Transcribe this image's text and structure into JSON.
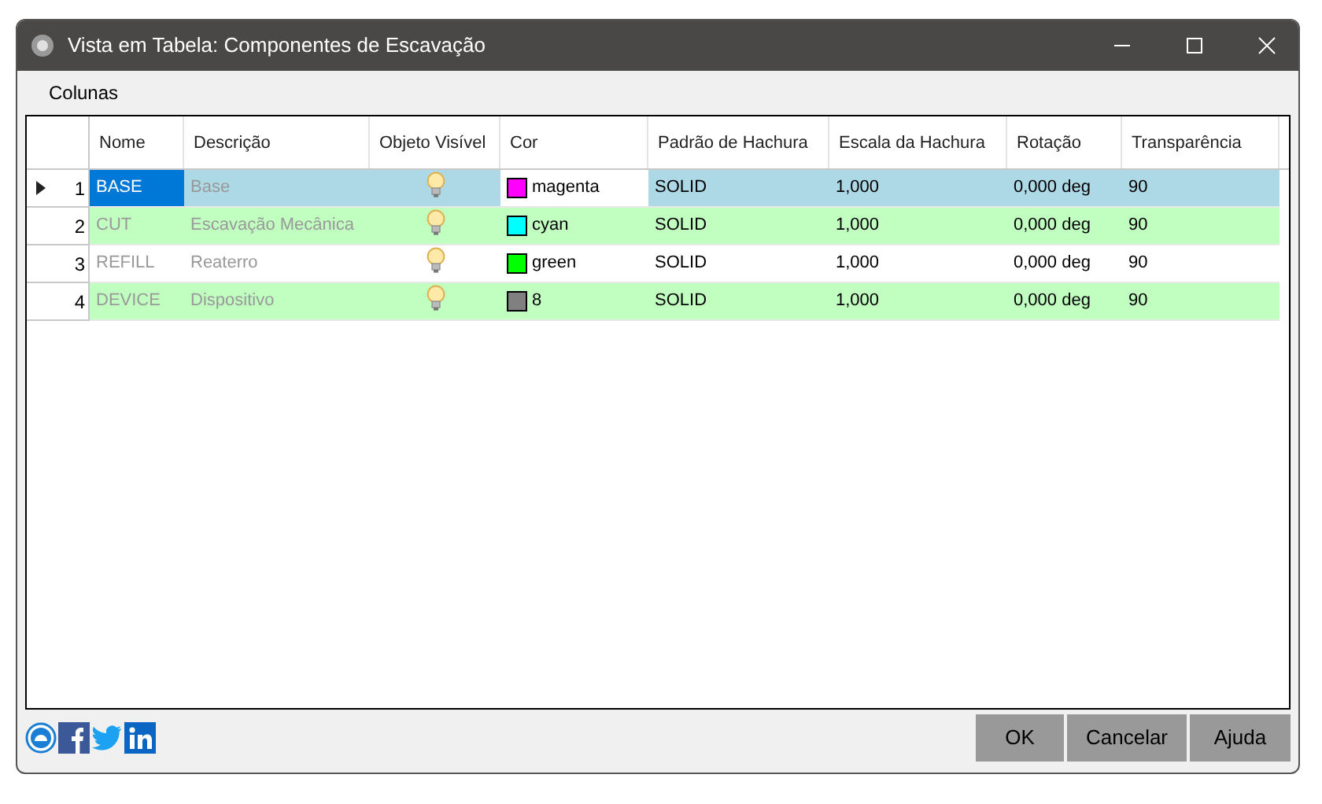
{
  "window": {
    "title": "Vista em Tabela: Componentes de Escavação"
  },
  "menu": [
    "Colunas"
  ],
  "table": {
    "columns": [
      "Nome",
      "Descrição",
      "Objeto Visível",
      "Cor",
      "Padrão de Hachura",
      "Escala da Hachura",
      "Rotação",
      "Transparência"
    ],
    "rows": [
      {
        "index": "1",
        "selected": true,
        "name": "BASE",
        "description": "Base",
        "visible": true,
        "color": "#ff00ff",
        "color_name": "magenta",
        "pattern": "SOLID",
        "scale": "1,000",
        "rotation": "0,000 deg",
        "transparency": "90"
      },
      {
        "index": "2",
        "selected": false,
        "name": "CUT",
        "description": "Escavação Mecânica",
        "visible": true,
        "color": "#00ffff",
        "color_name": "cyan",
        "pattern": "SOLID",
        "scale": "1,000",
        "rotation": "0,000 deg",
        "transparency": "90"
      },
      {
        "index": "3",
        "selected": false,
        "name": "REFILL",
        "description": "Reaterro",
        "visible": true,
        "color": "#00ff00",
        "color_name": "green",
        "pattern": "SOLID",
        "scale": "1,000",
        "rotation": "0,000 deg",
        "transparency": "90"
      },
      {
        "index": "4",
        "selected": false,
        "name": "DEVICE",
        "description": "Dispositivo",
        "visible": true,
        "color": "#808080",
        "color_name": "8",
        "pattern": "SOLID",
        "scale": "1,000",
        "rotation": "0,000 deg",
        "transparency": "90"
      }
    ]
  },
  "buttons": [
    "OK",
    "Cancelar",
    "Ajuda"
  ]
}
